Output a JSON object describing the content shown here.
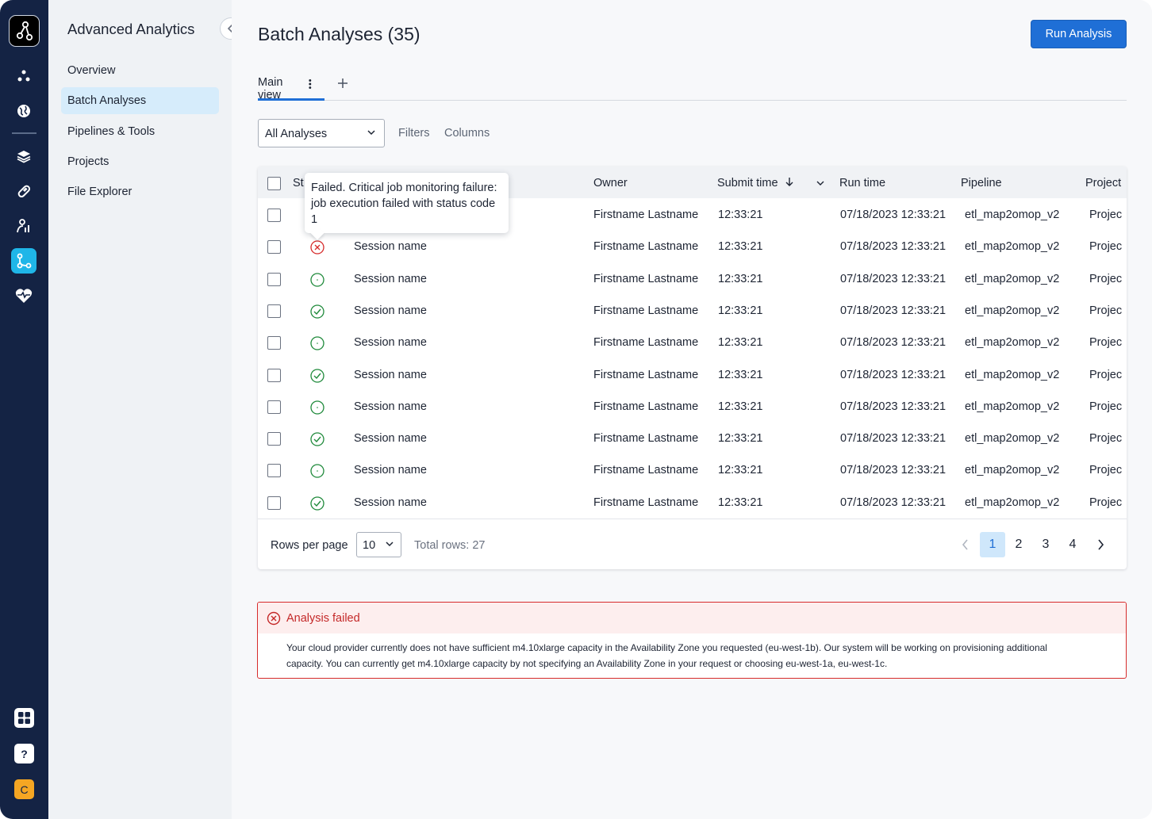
{
  "colors": {
    "rail": "#142344",
    "accent": "#1f6fd6",
    "success": "#1f8a3b",
    "error": "#d62b2b"
  },
  "sidebar": {
    "title": "Advanced Analytics",
    "items": [
      {
        "label": "Overview",
        "active": false
      },
      {
        "label": "Batch Analyses",
        "active": true
      },
      {
        "label": "Pipelines & Tools",
        "active": false
      },
      {
        "label": "Projects",
        "active": false
      },
      {
        "label": "File Explorer",
        "active": false
      }
    ]
  },
  "header": {
    "title": "Batch Analyses (35)",
    "run_button": "Run Analysis"
  },
  "tabs": {
    "main": "Main view"
  },
  "toolbar": {
    "select_value": "All Analyses",
    "filters": "Filters",
    "columns": "Columns"
  },
  "table": {
    "columns": {
      "status": "St",
      "owner": "Owner",
      "submit": "Submit time",
      "runtime": "Run time",
      "pipeline": "Pipeline",
      "project": "Project"
    },
    "tooltip": "Failed. Critical job monitoring failure: job execution failed with status code 1",
    "rows": [
      {
        "status": "hidden",
        "name": "",
        "owner": "Firstname Lastname",
        "submit": "12:33:21",
        "runtime": "07/18/2023 12:33:21",
        "pipeline": "etl_map2omop_v2",
        "project": "Projec"
      },
      {
        "status": "failed",
        "name": "Session name",
        "owner": "Firstname Lastname",
        "submit": "12:33:21",
        "runtime": "07/18/2023 12:33:21",
        "pipeline": "etl_map2omop_v2",
        "project": "Projec"
      },
      {
        "status": "running",
        "name": "Session name",
        "owner": "Firstname Lastname",
        "submit": "12:33:21",
        "runtime": "07/18/2023 12:33:21",
        "pipeline": "etl_map2omop_v2",
        "project": "Projec"
      },
      {
        "status": "success",
        "name": "Session name",
        "owner": "Firstname Lastname",
        "submit": "12:33:21",
        "runtime": "07/18/2023 12:33:21",
        "pipeline": "etl_map2omop_v2",
        "project": "Projec"
      },
      {
        "status": "running",
        "name": "Session name",
        "owner": "Firstname Lastname",
        "submit": "12:33:21",
        "runtime": "07/18/2023 12:33:21",
        "pipeline": "etl_map2omop_v2",
        "project": "Projec"
      },
      {
        "status": "success",
        "name": "Session name",
        "owner": "Firstname Lastname",
        "submit": "12:33:21",
        "runtime": "07/18/2023 12:33:21",
        "pipeline": "etl_map2omop_v2",
        "project": "Projec"
      },
      {
        "status": "running",
        "name": "Session name",
        "owner": "Firstname Lastname",
        "submit": "12:33:21",
        "runtime": "07/18/2023 12:33:21",
        "pipeline": "etl_map2omop_v2",
        "project": "Projec"
      },
      {
        "status": "success",
        "name": "Session name",
        "owner": "Firstname Lastname",
        "submit": "12:33:21",
        "runtime": "07/18/2023 12:33:21",
        "pipeline": "etl_map2omop_v2",
        "project": "Projec"
      },
      {
        "status": "running",
        "name": "Session name",
        "owner": "Firstname Lastname",
        "submit": "12:33:21",
        "runtime": "07/18/2023 12:33:21",
        "pipeline": "etl_map2omop_v2",
        "project": "Projec"
      },
      {
        "status": "success",
        "name": "Session name",
        "owner": "Firstname Lastname",
        "submit": "12:33:21",
        "runtime": "07/18/2023 12:33:21",
        "pipeline": "etl_map2omop_v2",
        "project": "Projec"
      }
    ]
  },
  "pagination": {
    "rows_per_page_label": "Rows per page",
    "rows_per_page": "10",
    "total": "Total rows: 27",
    "pages": [
      "1",
      "2",
      "3",
      "4"
    ],
    "current": "1"
  },
  "alert": {
    "title": "Analysis failed",
    "body_line1": "Your cloud provider currently does not have sufficient m4.10xlarge capacity in the Availability Zone you requested (eu-west-1b). Our system will be working on provisioning additional",
    "body_line2": "capacity. You can currently get m4.10xlarge capacity by not specifying an Availability Zone in your request or choosing eu-west-1a, eu-west-1c."
  },
  "rail": {
    "avatar_letter": "C",
    "help_glyph": "?"
  }
}
